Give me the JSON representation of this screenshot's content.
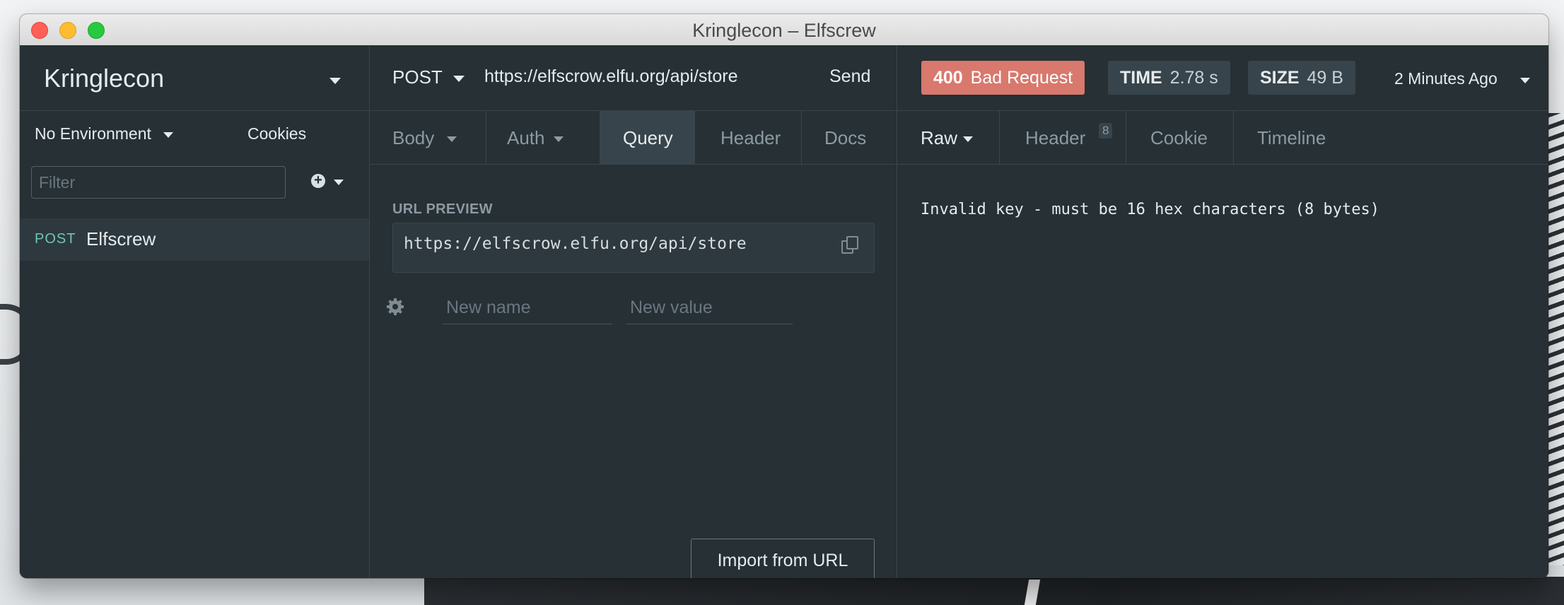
{
  "window": {
    "title": "Kringlecon – Elfscrew"
  },
  "sidebar": {
    "workspace": "Kringlecon",
    "environment": "No Environment",
    "cookies": "Cookies",
    "filter_placeholder": "Filter",
    "requests": [
      {
        "method": "POST",
        "name": "Elfscrew"
      }
    ]
  },
  "request": {
    "method": "POST",
    "url": "https://elfscrow.elfu.org/api/store",
    "send": "Send",
    "tabs": [
      "Body",
      "Auth",
      "Query",
      "Header",
      "Docs"
    ],
    "active_tab": "Query",
    "url_preview_label": "URL PREVIEW",
    "url_preview": "https://elfscrow.elfu.org/api/store",
    "param_name_placeholder": "New name",
    "param_value_placeholder": "New value",
    "import_button": "Import from URL"
  },
  "response": {
    "status_code": "400",
    "status_text": "Bad Request",
    "time_label": "TIME",
    "time_value": "2.78 s",
    "size_label": "SIZE",
    "size_value": "49 B",
    "history": "2 Minutes Ago",
    "tabs": [
      "Raw",
      "Header",
      "Cookie",
      "Timeline"
    ],
    "header_count": "8",
    "body": "Invalid key - must be 16 hex characters (8 bytes)"
  },
  "colors": {
    "status_error": "#d9786d",
    "pane_bg": "#263035",
    "method_post": "#73c3b4"
  }
}
